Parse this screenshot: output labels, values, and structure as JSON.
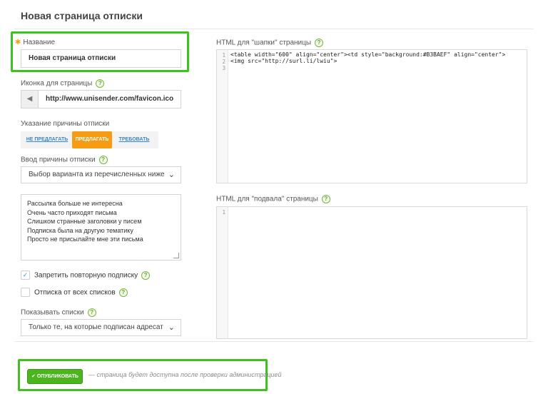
{
  "page": {
    "title": "Новая страница отписки"
  },
  "name_field": {
    "label": "Название",
    "value": "Новая страница отписки"
  },
  "icon_field": {
    "label": "Иконка для страницы",
    "value": "http://www.unisender.com/favicon.ico",
    "icon": "speaker-favicon-icon"
  },
  "reason": {
    "label": "Указание причины отписки",
    "options": [
      "НЕ ПРЕДЛАГАТЬ",
      "ПРЕДЛАГАТЬ",
      "ТРЕБОВАТЬ"
    ],
    "selected": "ПРЕДЛАГАТЬ"
  },
  "reason_input": {
    "label": "Ввод причины отписки",
    "value": "Выбор варианта из перечисленных ниже"
  },
  "reasons_list": [
    "Рассылка больше не интересна",
    "Очень часто приходят письма",
    "Слишком странные заголовки у писем",
    "Подписка была на другую тематику",
    "Просто не присылайте мне эти письма"
  ],
  "checkboxes": [
    {
      "label": "Запретить повторную подписку",
      "checked": true
    },
    {
      "label": "Отписка от всех списков",
      "checked": false
    }
  ],
  "show_lists": {
    "label": "Показывать списки",
    "value": "Только те, на которые подписан адресат"
  },
  "header_html": {
    "label": "HTML для \"шапки\" страницы",
    "lines": [
      "<table width=\"600\" align=\"center\"><td style=\"background:#B3BAEF\" align=\"center\">",
      "<img src=\"http://surl.li/lwiu\">",
      ""
    ],
    "line_numbers": [
      "1",
      "2",
      "3"
    ]
  },
  "footer_html": {
    "label": "HTML для \"подвала\" страницы",
    "line_numbers": [
      "1"
    ]
  },
  "publish": {
    "button_label": "ОПУБЛИКОВАТЬ",
    "note": "— страница будет доступна после проверки администрацией"
  },
  "colors": {
    "accent_green": "#3ec21f",
    "active_orange": "#f79b12",
    "link_blue": "#3b87c2"
  }
}
